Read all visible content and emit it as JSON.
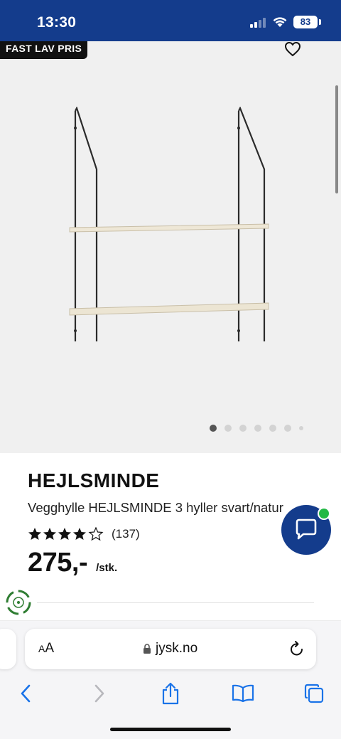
{
  "status": {
    "time": "13:30",
    "battery": "83"
  },
  "product_image": {
    "badge": "FAST LAV PRIS",
    "carousel_total": 7,
    "carousel_active": 1
  },
  "product": {
    "brand": "HEJLSMINDE",
    "description": "Vegghylle HEJLSMINDE 3 hyller svart/natur",
    "rating_stars": 4,
    "review_count": "(137)",
    "price": "275,-",
    "unit": "/stk."
  },
  "browser": {
    "text_size_label_small": "A",
    "text_size_label_large": "A",
    "url": "jysk.no"
  },
  "colors": {
    "brand_blue": "#143c8c",
    "online_green": "#22b845",
    "ios_blue": "#1a73e8"
  },
  "icons": [
    "heart-icon",
    "chat-icon",
    "eco-icon",
    "lock-icon",
    "reload-icon",
    "back-icon",
    "forward-icon",
    "share-icon",
    "bookmarks-icon",
    "tabs-icon"
  ]
}
